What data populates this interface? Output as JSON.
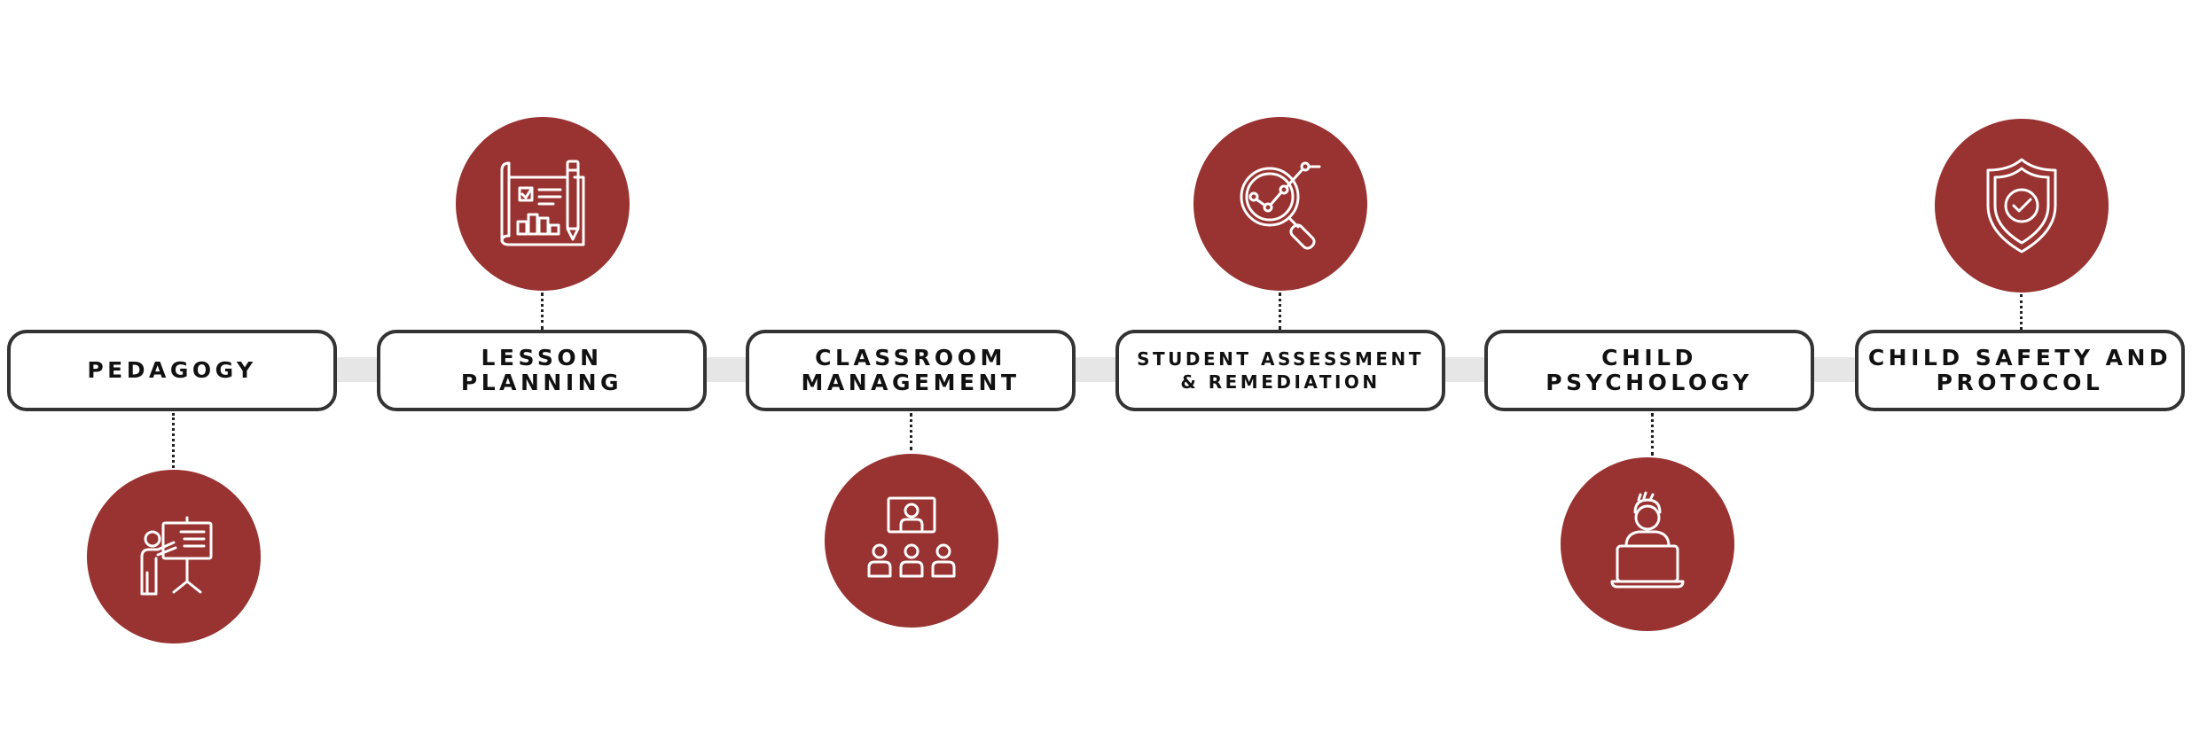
{
  "diagram": {
    "colors": {
      "circle_fill": "#983331",
      "box_border": "#333333",
      "rail": "#e6e6e6",
      "icon_stroke": "#ffffff",
      "text": "#111111"
    },
    "steps": [
      {
        "label": "PEDAGOGY",
        "icon": "presentation-teacher-icon",
        "icon_side": "below"
      },
      {
        "label": "LESSON\nPLANNING",
        "icon": "blueprint-plan-icon",
        "icon_side": "above"
      },
      {
        "label": "CLASSROOM\nMANAGEMENT",
        "icon": "classroom-audience-icon",
        "icon_side": "below"
      },
      {
        "label": "STUDENT ASSESSMENT\n& REMEDIATION",
        "icon": "magnifier-analytics-icon",
        "icon_side": "above"
      },
      {
        "label": "CHILD\nPSYCHOLOGY",
        "icon": "student-laptop-icon",
        "icon_side": "below"
      },
      {
        "label": "CHILD SAFETY AND\nPROTOCOL",
        "icon": "shield-check-icon",
        "icon_side": "above"
      }
    ]
  }
}
